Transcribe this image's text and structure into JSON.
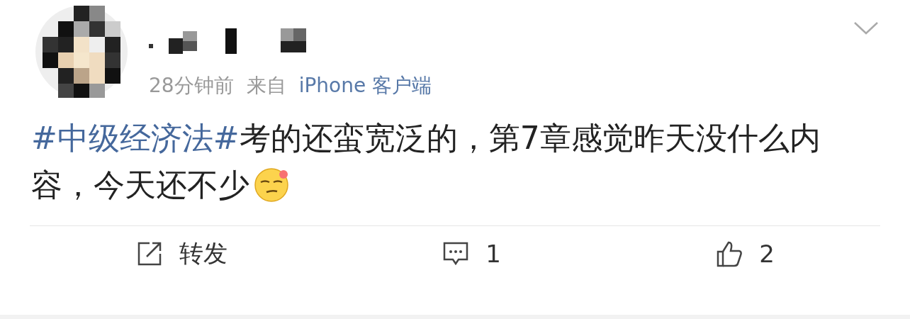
{
  "post": {
    "time": "28分钟前",
    "source_prefix": "来自",
    "source": "iPhone 客户端",
    "content": [
      {
        "kind": "hashtag",
        "text": "#中级经济法#"
      },
      {
        "kind": "text",
        "text": "考的还蛮宽泛的，第7章感觉昨天没什么内容，今天还不少"
      }
    ],
    "actions": [
      {
        "kind": "repost",
        "label": "转发"
      },
      {
        "kind": "comment",
        "label": "1"
      },
      {
        "kind": "like",
        "label": "2"
      }
    ]
  }
}
